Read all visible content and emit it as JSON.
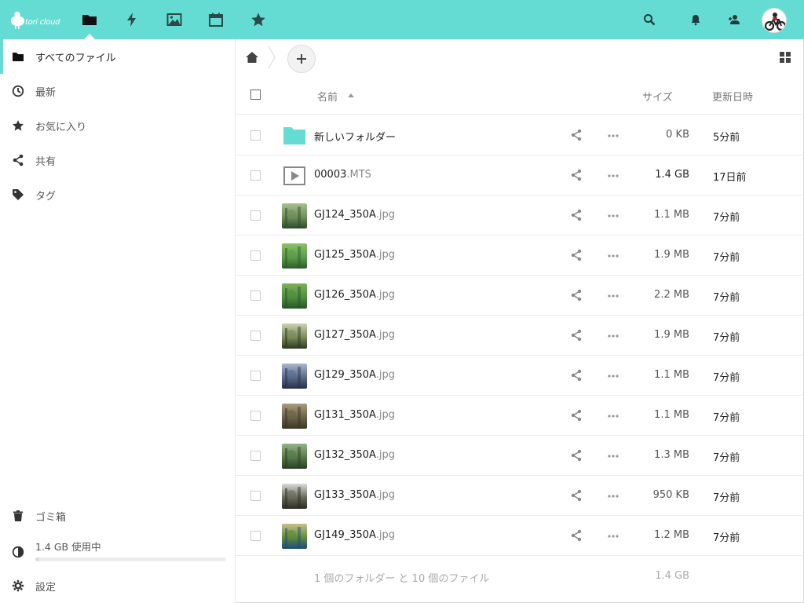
{
  "header": {
    "logo_text": "tori cloud",
    "apps": [
      {
        "name": "files",
        "icon": "folder-icon",
        "active": true
      },
      {
        "name": "activity",
        "icon": "lightning-icon"
      },
      {
        "name": "gallery",
        "icon": "image-icon"
      },
      {
        "name": "calendar",
        "icon": "calendar-icon"
      },
      {
        "name": "favorites",
        "icon": "star-icon"
      }
    ],
    "right_icons": [
      "search-icon",
      "bell-icon",
      "contacts-icon"
    ],
    "accent_color": "#65dcd3"
  },
  "sidebar": {
    "items": [
      {
        "label": "すべてのファイル",
        "icon": "folder-icon",
        "active": true
      },
      {
        "label": "最新",
        "icon": "clock-icon"
      },
      {
        "label": "お気に入り",
        "icon": "star-icon"
      },
      {
        "label": "共有",
        "icon": "share-icon"
      },
      {
        "label": "タグ",
        "icon": "tag-icon"
      }
    ],
    "trash": {
      "label": "ゴミ箱",
      "icon": "trash-icon"
    },
    "quota": {
      "label": "1.4 GB 使用中",
      "used_fraction": 0.02
    },
    "settings": {
      "label": "設定",
      "icon": "gear-icon"
    }
  },
  "table": {
    "headers": {
      "name": "名前",
      "size": "サイズ",
      "modified": "更新日時"
    },
    "sort": {
      "column": "name",
      "direction": "asc"
    },
    "rows": [
      {
        "name": "新しいフォルダー",
        "ext": "",
        "type": "folder",
        "size": "0 KB",
        "modified": "5分前"
      },
      {
        "name": "00003",
        "ext": ".MTS",
        "type": "video",
        "size": "1.4 GB",
        "modified": "17日前"
      },
      {
        "name": "GJ124_350A",
        "ext": ".jpg",
        "type": "image",
        "size": "1.1 MB",
        "modified": "7分前",
        "palette": [
          "#2f4a2b",
          "#6c8f5a",
          "#a8c090"
        ]
      },
      {
        "name": "GJ125_350A",
        "ext": ".jpg",
        "type": "image",
        "size": "1.9 MB",
        "modified": "7分前",
        "palette": [
          "#2d5d2a",
          "#5c9c4a",
          "#8dc06a"
        ]
      },
      {
        "name": "GJ126_350A",
        "ext": ".jpg",
        "type": "image",
        "size": "2.2 MB",
        "modified": "7分前",
        "palette": [
          "#27552a",
          "#4f8f3c",
          "#7fb15c"
        ]
      },
      {
        "name": "GJ127_350A",
        "ext": ".jpg",
        "type": "image",
        "size": "1.9 MB",
        "modified": "7分前",
        "palette": [
          "#2b3a22",
          "#7a8a5a",
          "#c9d2b0"
        ]
      },
      {
        "name": "GJ129_350A",
        "ext": ".jpg",
        "type": "image",
        "size": "1.1 MB",
        "modified": "7分前",
        "palette": [
          "#26304a",
          "#5a6a8a",
          "#a9b6cf"
        ]
      },
      {
        "name": "GJ131_350A",
        "ext": ".jpg",
        "type": "image",
        "size": "1.1 MB",
        "modified": "7分前",
        "palette": [
          "#3a3526",
          "#6b6248",
          "#a89d7c"
        ]
      },
      {
        "name": "GJ132_350A",
        "ext": ".jpg",
        "type": "image",
        "size": "1.3 MB",
        "modified": "7分前",
        "palette": [
          "#2a3d24",
          "#557a4a",
          "#96b38a"
        ]
      },
      {
        "name": "GJ133_350A",
        "ext": ".jpg",
        "type": "image",
        "size": "950 KB",
        "modified": "7分前",
        "palette": [
          "#2b2b22",
          "#6a6a5a",
          "#d8dcd8"
        ]
      },
      {
        "name": "GJ149_350A",
        "ext": ".jpg",
        "type": "image",
        "size": "1.2 MB",
        "modified": "7分前",
        "palette": [
          "#1f4a7a",
          "#5f8a3a",
          "#c8c08a"
        ]
      }
    ],
    "summary": {
      "text": "1 個のフォルダー と 10 個のファイル",
      "size": "1.4 GB"
    }
  }
}
